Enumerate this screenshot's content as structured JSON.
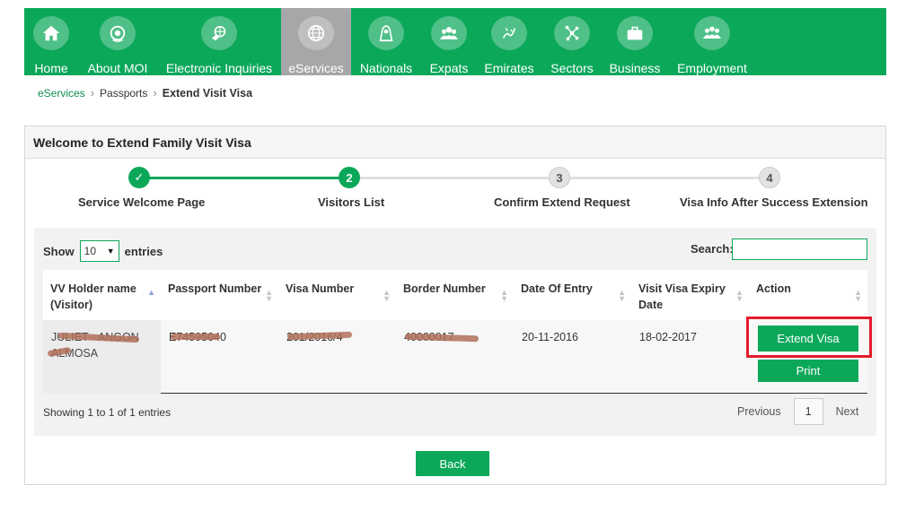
{
  "nav": {
    "items": [
      {
        "label": "Home",
        "icon": "home-icon"
      },
      {
        "label": "About MOI",
        "icon": "emblem-icon"
      },
      {
        "label": "Electronic Inquiries",
        "icon": "hand-globe-icon"
      },
      {
        "label": "eServices",
        "icon": "globe-icon"
      },
      {
        "label": "Nationals",
        "icon": "person-icon"
      },
      {
        "label": "Expats",
        "icon": "group-icon"
      },
      {
        "label": "Emirates",
        "icon": "calligraphy-icon"
      },
      {
        "label": "Sectors",
        "icon": "network-icon"
      },
      {
        "label": "Business",
        "icon": "briefcase-icon"
      },
      {
        "label": "Employment",
        "icon": "team-icon"
      }
    ],
    "active": "eServices"
  },
  "breadcrumb": {
    "items": [
      "eServices",
      "Passports"
    ],
    "current": "Extend Visit Visa"
  },
  "panel": {
    "title": "Welcome to Extend Family Visit Visa"
  },
  "steps": [
    {
      "num": "✓",
      "label": "Service Welcome Page",
      "state": "done"
    },
    {
      "num": "2",
      "label": "Visitors List",
      "state": "current"
    },
    {
      "num": "3",
      "label": "Confirm Extend Request",
      "state": "pending"
    },
    {
      "num": "4",
      "label": "Visa Info After Success Extension",
      "state": "pending"
    }
  ],
  "table": {
    "show_label": "Show",
    "entries_label": "entries",
    "page_size": "10",
    "search_label": "Search:",
    "headers": [
      "VV Holder name (Visitor)",
      "Passport Number",
      "Visa Number",
      "Border Number",
      "Date Of Entry",
      "Visit Visa Expiry Date",
      "Action"
    ],
    "rows": [
      {
        "name_line1": "JULIET · ANGON",
        "name_line2": "ALMOSA",
        "passport": "E74595040",
        "visa": "201/2016/4",
        "border": "40000017",
        "date_entry": "20-11-2016",
        "expiry": "18-02-2017",
        "action_primary": "Extend Visa",
        "action_secondary": "Print"
      }
    ],
    "info": "Showing 1 to 1 of 1 entries",
    "pager": {
      "previous": "Previous",
      "page": "1",
      "next": "Next"
    }
  },
  "back_label": "Back",
  "colors": {
    "brand": "#0ca85a",
    "active_nav": "#a5a7a9",
    "highlight": "#e41a2b"
  }
}
